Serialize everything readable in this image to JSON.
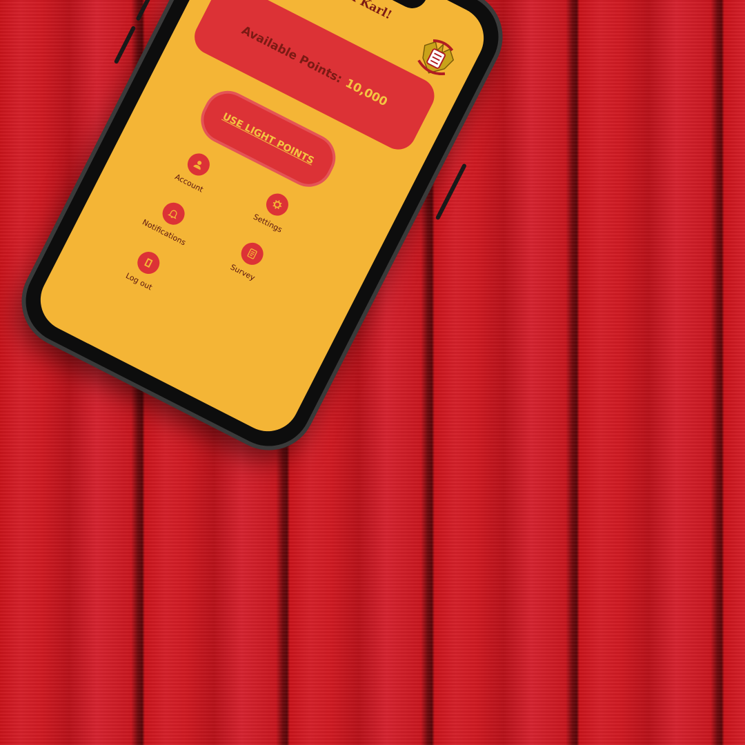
{
  "header": {
    "welcome_text": "Welcome, Jun Karl!"
  },
  "points_card": {
    "label": "Available Points:",
    "value": "10,000"
  },
  "actions": {
    "use_light_points_label": "USE LIGHT POINTS"
  },
  "menu": [
    {
      "label": "Account",
      "icon": "user-icon"
    },
    {
      "label": "Settings",
      "icon": "gear-icon"
    },
    {
      "label": "Notifications",
      "icon": "bell-icon"
    },
    {
      "label": "Survey",
      "icon": "list-icon"
    },
    {
      "label": "Log out",
      "icon": "logout-icon"
    }
  ],
  "colors": {
    "screen_background": "#f4b536",
    "accent_red": "#dc3236",
    "dark_text": "#7b1a14",
    "highlight_yellow": "#f4c542"
  }
}
